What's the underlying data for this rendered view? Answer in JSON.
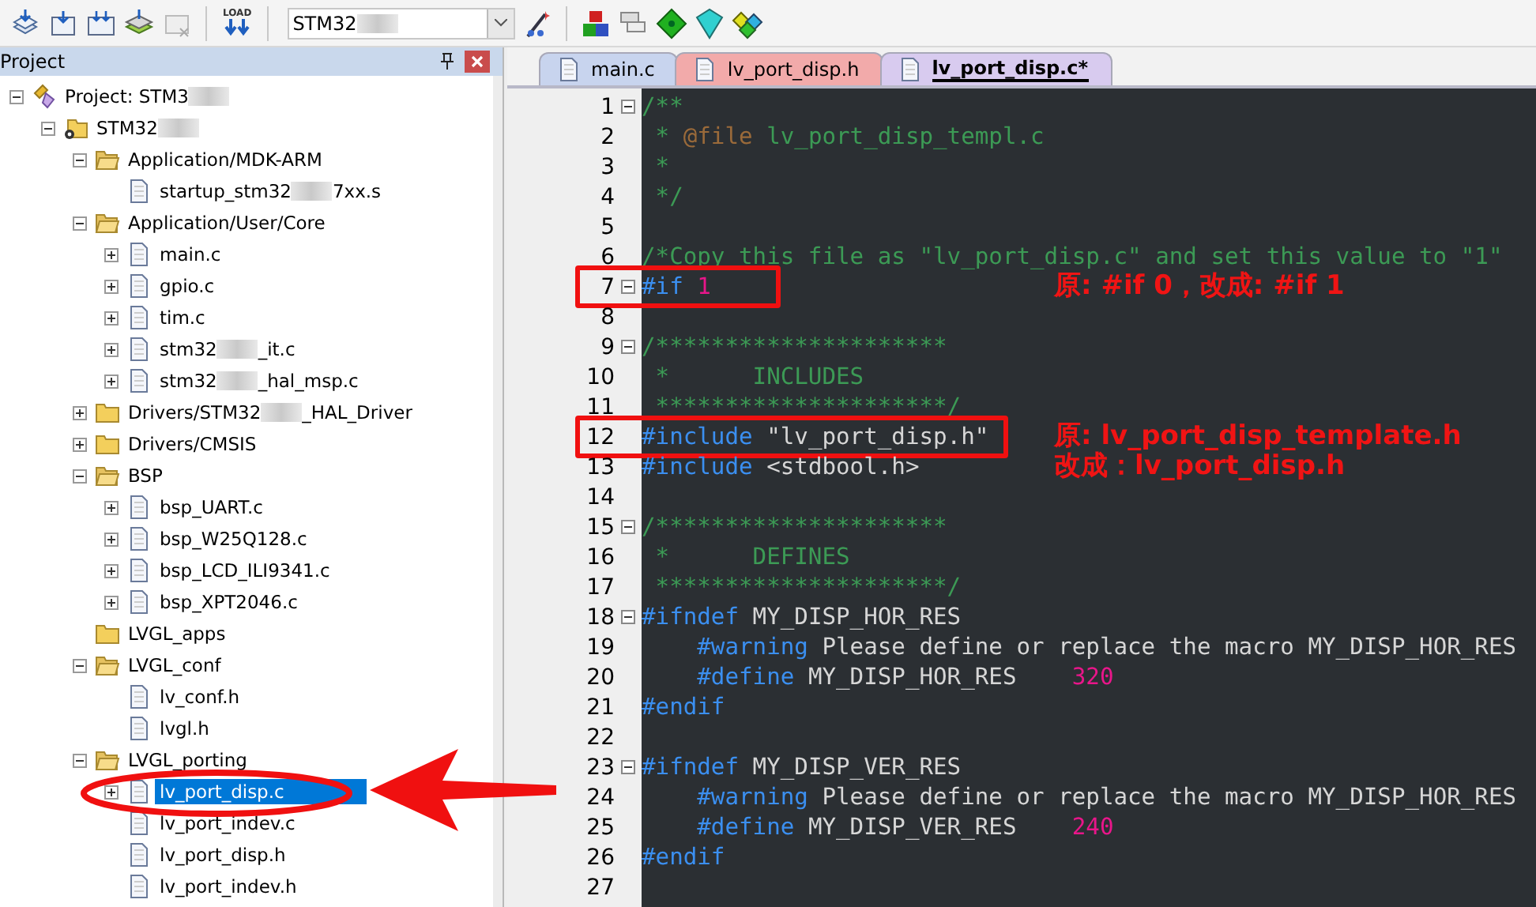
{
  "toolbar": {
    "load_label": "LOAD",
    "target_combo": {
      "value": "STM32",
      "redacted": true
    }
  },
  "project_panel": {
    "title": "Project",
    "tree": [
      {
        "label": "Project: STM3",
        "kind": "project",
        "redacted": true,
        "expanded": true,
        "selected": false,
        "children": [
          {
            "label": "STM32",
            "kind": "target",
            "redacted": true,
            "expanded": true,
            "selected": false,
            "children": [
              {
                "label": "Application/MDK-ARM",
                "kind": "folder",
                "expanded": true,
                "selected": false,
                "children": [
                  {
                    "label": "startup_stm32",
                    "label_tail": "7xx.s",
                    "kind": "file",
                    "redacted": true,
                    "selected": false
                  }
                ]
              },
              {
                "label": "Application/User/Core",
                "kind": "folder",
                "expanded": true,
                "selected": false,
                "children": [
                  {
                    "label": "main.c",
                    "kind": "file",
                    "expanded": false,
                    "selected": false
                  },
                  {
                    "label": "gpio.c",
                    "kind": "file",
                    "expanded": false,
                    "selected": false
                  },
                  {
                    "label": "tim.c",
                    "kind": "file",
                    "expanded": false,
                    "selected": false
                  },
                  {
                    "label": "stm32",
                    "label_tail": "_it.c",
                    "kind": "file",
                    "redacted": true,
                    "expanded": false,
                    "selected": false
                  },
                  {
                    "label": "stm32",
                    "label_tail": "_hal_msp.c",
                    "kind": "file",
                    "redacted": true,
                    "expanded": false,
                    "selected": false
                  }
                ]
              },
              {
                "label": "Drivers/STM32",
                "label_tail": "_HAL_Driver",
                "kind": "folder",
                "redacted": true,
                "expanded": false,
                "selected": false
              },
              {
                "label": "Drivers/CMSIS",
                "kind": "folder",
                "expanded": false,
                "selected": false
              },
              {
                "label": "BSP",
                "kind": "folder",
                "expanded": true,
                "selected": false,
                "children": [
                  {
                    "label": "bsp_UART.c",
                    "kind": "file",
                    "expanded": false,
                    "selected": false
                  },
                  {
                    "label": "bsp_W25Q128.c",
                    "kind": "file",
                    "expanded": false,
                    "selected": false
                  },
                  {
                    "label": "bsp_LCD_ILI9341.c",
                    "kind": "file",
                    "expanded": false,
                    "selected": false
                  },
                  {
                    "label": "bsp_XPT2046.c",
                    "kind": "file",
                    "expanded": false,
                    "selected": false
                  }
                ]
              },
              {
                "label": "LVGL_apps",
                "kind": "folder",
                "selected": false
              },
              {
                "label": "LVGL_conf",
                "kind": "folder",
                "expanded": true,
                "selected": false,
                "children": [
                  {
                    "label": "lv_conf.h",
                    "kind": "file",
                    "selected": false
                  },
                  {
                    "label": "lvgl.h",
                    "kind": "file",
                    "selected": false
                  }
                ]
              },
              {
                "label": "LVGL_porting",
                "kind": "folder",
                "expanded": true,
                "selected": false,
                "children": [
                  {
                    "label": "lv_port_disp.c",
                    "kind": "file",
                    "expanded": false,
                    "selected": true
                  },
                  {
                    "label": "lv_port_indev.c",
                    "kind": "file",
                    "selected": false
                  },
                  {
                    "label": "lv_port_disp.h",
                    "kind": "file",
                    "selected": false
                  },
                  {
                    "label": "lv_port_indev.h",
                    "kind": "file",
                    "selected": false
                  }
                ]
              }
            ]
          }
        ]
      }
    ]
  },
  "editor": {
    "tabs": [
      {
        "label": "main.c",
        "color": "#c8d4ee",
        "selected": false
      },
      {
        "label": "lv_port_disp.h",
        "color": "#f2aaaa",
        "selected": false
      },
      {
        "label": "lv_port_disp.c*",
        "color": "#d8cbef",
        "selected": true
      }
    ],
    "lines": [
      {
        "n": "1",
        "fold": true,
        "boxed": false,
        "tokens": [
          {
            "kind": "comment",
            "text": "/**"
          }
        ]
      },
      {
        "n": "2",
        "fold": false,
        "boxed": false,
        "tokens": [
          {
            "kind": "comment",
            "text": " * "
          },
          {
            "kind": "doc",
            "text": "@file"
          },
          {
            "kind": "comment",
            "text": " lv_port_disp_templ.c"
          }
        ]
      },
      {
        "n": "3",
        "fold": false,
        "boxed": false,
        "tokens": [
          {
            "kind": "comment",
            "text": " *"
          }
        ]
      },
      {
        "n": "4",
        "fold": false,
        "boxed": false,
        "tokens": [
          {
            "kind": "comment",
            "text": " */"
          }
        ]
      },
      {
        "n": "5",
        "fold": false,
        "boxed": false
      },
      {
        "n": "6",
        "fold": false,
        "boxed": false,
        "tokens": [
          {
            "kind": "comment",
            "text": "/*Copy this file as \"lv_port_disp.c\" and set this value to \"1\""
          }
        ]
      },
      {
        "n": "7",
        "fold": true,
        "boxed": true,
        "tokens": [
          {
            "kind": "directive",
            "text": "#if"
          },
          {
            "kind": "number",
            "text": " 1"
          }
        ],
        "note": "原: #if 0，改成: #if 1"
      },
      {
        "n": "8",
        "fold": false,
        "boxed": false
      },
      {
        "n": "9",
        "fold": true,
        "boxed": false,
        "tokens": [
          {
            "kind": "comment",
            "text": "/*********************"
          }
        ]
      },
      {
        "n": "10",
        "fold": false,
        "boxed": false,
        "tokens": [
          {
            "kind": "comment",
            "text": " *      INCLUDES"
          }
        ]
      },
      {
        "n": "11",
        "fold": false,
        "boxed": false,
        "tokens": [
          {
            "kind": "comment",
            "text": " *********************/"
          }
        ]
      },
      {
        "n": "12",
        "fold": false,
        "boxed": true,
        "tokens": [
          {
            "kind": "directive",
            "text": "#include"
          },
          {
            "kind": "plain",
            "text": " \"lv_port_disp.h\""
          }
        ],
        "note": "原: lv_port_disp_template.h"
      },
      {
        "n": "13",
        "fold": false,
        "boxed": false,
        "tokens": [
          {
            "kind": "directive",
            "text": "#include"
          },
          {
            "kind": "plain",
            "text": " <stdbool.h>"
          }
        ],
        "note": "改成：lv_port_disp.h"
      },
      {
        "n": "14",
        "fold": false,
        "boxed": false
      },
      {
        "n": "15",
        "fold": true,
        "boxed": false,
        "tokens": [
          {
            "kind": "comment",
            "text": "/*********************"
          }
        ]
      },
      {
        "n": "16",
        "fold": false,
        "boxed": false,
        "tokens": [
          {
            "kind": "comment",
            "text": " *      DEFINES"
          }
        ]
      },
      {
        "n": "17",
        "fold": false,
        "boxed": false,
        "tokens": [
          {
            "kind": "comment",
            "text": " *********************/"
          }
        ]
      },
      {
        "n": "18",
        "fold": true,
        "boxed": false,
        "tokens": [
          {
            "kind": "directive",
            "text": "#ifndef"
          },
          {
            "kind": "plain",
            "text": " MY_DISP_HOR_RES"
          }
        ]
      },
      {
        "n": "19",
        "fold": false,
        "boxed": false,
        "tokens": [
          {
            "kind": "directive",
            "text": "    #warning"
          },
          {
            "kind": "plain",
            "text": " Please define or replace the macro MY_DISP_HOR_RES"
          }
        ]
      },
      {
        "n": "20",
        "fold": false,
        "boxed": false,
        "tokens": [
          {
            "kind": "directive",
            "text": "    #define"
          },
          {
            "kind": "plain",
            "text": " MY_DISP_HOR_RES    "
          },
          {
            "kind": "number",
            "text": "320"
          }
        ]
      },
      {
        "n": "21",
        "fold": false,
        "boxed": false,
        "tokens": [
          {
            "kind": "directive",
            "text": "#endif"
          }
        ]
      },
      {
        "n": "22",
        "fold": false,
        "boxed": false
      },
      {
        "n": "23",
        "fold": true,
        "boxed": false,
        "tokens": [
          {
            "kind": "directive",
            "text": "#ifndef"
          },
          {
            "kind": "plain",
            "text": " MY_DISP_VER_RES"
          }
        ]
      },
      {
        "n": "24",
        "fold": false,
        "boxed": false,
        "tokens": [
          {
            "kind": "directive",
            "text": "    #warning"
          },
          {
            "kind": "plain",
            "text": " Please define or replace the macro MY_DISP_HOR_RES"
          }
        ]
      },
      {
        "n": "25",
        "fold": false,
        "boxed": false,
        "tokens": [
          {
            "kind": "directive",
            "text": "    #define"
          },
          {
            "kind": "plain",
            "text": " MY_DISP_VER_RES    "
          },
          {
            "kind": "number",
            "text": "240"
          }
        ]
      },
      {
        "n": "26",
        "fold": false,
        "boxed": false,
        "tokens": [
          {
            "kind": "directive",
            "text": "#endif"
          }
        ]
      },
      {
        "n": "27",
        "fold": false,
        "boxed": false
      }
    ]
  }
}
